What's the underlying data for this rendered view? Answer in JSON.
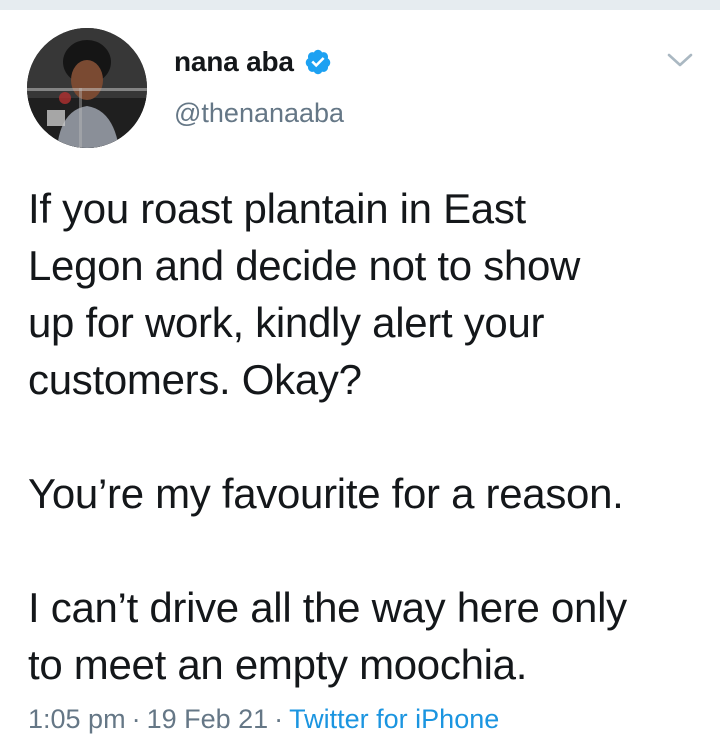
{
  "tweet": {
    "author": {
      "display_name": "nana aba",
      "handle": "@thenanaaba",
      "verified": true
    },
    "paragraphs": [
      "If you roast plantain in East\nLegon and decide not to show\nup for work, kindly alert your\ncustomers. Okay?",
      "You’re my favourite for a reason.",
      "I can’t drive all the way here only\nto meet an empty moochia."
    ],
    "time": "1:05 pm",
    "separator": "·",
    "date": "19 Feb 21",
    "source": "Twitter for iPhone"
  },
  "icons": {
    "verified": "verified-badge-icon",
    "menu": "chevron-down-icon"
  },
  "colors": {
    "text": "#14171a",
    "secondary": "#657786",
    "link": "#1b95e0",
    "verified": "#1da1f2"
  }
}
